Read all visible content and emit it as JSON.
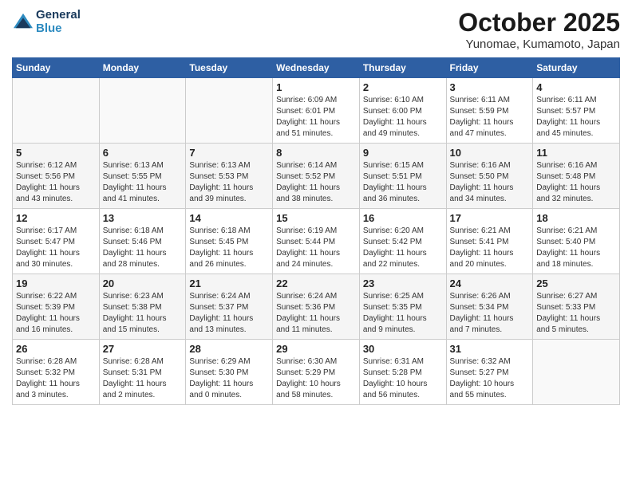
{
  "header": {
    "logo_line1": "General",
    "logo_line2": "Blue",
    "month": "October 2025",
    "location": "Yunomae, Kumamoto, Japan"
  },
  "weekdays": [
    "Sunday",
    "Monday",
    "Tuesday",
    "Wednesday",
    "Thursday",
    "Friday",
    "Saturday"
  ],
  "weeks": [
    [
      {
        "day": "",
        "info": ""
      },
      {
        "day": "",
        "info": ""
      },
      {
        "day": "",
        "info": ""
      },
      {
        "day": "1",
        "info": "Sunrise: 6:09 AM\nSunset: 6:01 PM\nDaylight: 11 hours\nand 51 minutes."
      },
      {
        "day": "2",
        "info": "Sunrise: 6:10 AM\nSunset: 6:00 PM\nDaylight: 11 hours\nand 49 minutes."
      },
      {
        "day": "3",
        "info": "Sunrise: 6:11 AM\nSunset: 5:59 PM\nDaylight: 11 hours\nand 47 minutes."
      },
      {
        "day": "4",
        "info": "Sunrise: 6:11 AM\nSunset: 5:57 PM\nDaylight: 11 hours\nand 45 minutes."
      }
    ],
    [
      {
        "day": "5",
        "info": "Sunrise: 6:12 AM\nSunset: 5:56 PM\nDaylight: 11 hours\nand 43 minutes."
      },
      {
        "day": "6",
        "info": "Sunrise: 6:13 AM\nSunset: 5:55 PM\nDaylight: 11 hours\nand 41 minutes."
      },
      {
        "day": "7",
        "info": "Sunrise: 6:13 AM\nSunset: 5:53 PM\nDaylight: 11 hours\nand 39 minutes."
      },
      {
        "day": "8",
        "info": "Sunrise: 6:14 AM\nSunset: 5:52 PM\nDaylight: 11 hours\nand 38 minutes."
      },
      {
        "day": "9",
        "info": "Sunrise: 6:15 AM\nSunset: 5:51 PM\nDaylight: 11 hours\nand 36 minutes."
      },
      {
        "day": "10",
        "info": "Sunrise: 6:16 AM\nSunset: 5:50 PM\nDaylight: 11 hours\nand 34 minutes."
      },
      {
        "day": "11",
        "info": "Sunrise: 6:16 AM\nSunset: 5:48 PM\nDaylight: 11 hours\nand 32 minutes."
      }
    ],
    [
      {
        "day": "12",
        "info": "Sunrise: 6:17 AM\nSunset: 5:47 PM\nDaylight: 11 hours\nand 30 minutes."
      },
      {
        "day": "13",
        "info": "Sunrise: 6:18 AM\nSunset: 5:46 PM\nDaylight: 11 hours\nand 28 minutes."
      },
      {
        "day": "14",
        "info": "Sunrise: 6:18 AM\nSunset: 5:45 PM\nDaylight: 11 hours\nand 26 minutes."
      },
      {
        "day": "15",
        "info": "Sunrise: 6:19 AM\nSunset: 5:44 PM\nDaylight: 11 hours\nand 24 minutes."
      },
      {
        "day": "16",
        "info": "Sunrise: 6:20 AM\nSunset: 5:42 PM\nDaylight: 11 hours\nand 22 minutes."
      },
      {
        "day": "17",
        "info": "Sunrise: 6:21 AM\nSunset: 5:41 PM\nDaylight: 11 hours\nand 20 minutes."
      },
      {
        "day": "18",
        "info": "Sunrise: 6:21 AM\nSunset: 5:40 PM\nDaylight: 11 hours\nand 18 minutes."
      }
    ],
    [
      {
        "day": "19",
        "info": "Sunrise: 6:22 AM\nSunset: 5:39 PM\nDaylight: 11 hours\nand 16 minutes."
      },
      {
        "day": "20",
        "info": "Sunrise: 6:23 AM\nSunset: 5:38 PM\nDaylight: 11 hours\nand 15 minutes."
      },
      {
        "day": "21",
        "info": "Sunrise: 6:24 AM\nSunset: 5:37 PM\nDaylight: 11 hours\nand 13 minutes."
      },
      {
        "day": "22",
        "info": "Sunrise: 6:24 AM\nSunset: 5:36 PM\nDaylight: 11 hours\nand 11 minutes."
      },
      {
        "day": "23",
        "info": "Sunrise: 6:25 AM\nSunset: 5:35 PM\nDaylight: 11 hours\nand 9 minutes."
      },
      {
        "day": "24",
        "info": "Sunrise: 6:26 AM\nSunset: 5:34 PM\nDaylight: 11 hours\nand 7 minutes."
      },
      {
        "day": "25",
        "info": "Sunrise: 6:27 AM\nSunset: 5:33 PM\nDaylight: 11 hours\nand 5 minutes."
      }
    ],
    [
      {
        "day": "26",
        "info": "Sunrise: 6:28 AM\nSunset: 5:32 PM\nDaylight: 11 hours\nand 3 minutes."
      },
      {
        "day": "27",
        "info": "Sunrise: 6:28 AM\nSunset: 5:31 PM\nDaylight: 11 hours\nand 2 minutes."
      },
      {
        "day": "28",
        "info": "Sunrise: 6:29 AM\nSunset: 5:30 PM\nDaylight: 11 hours\nand 0 minutes."
      },
      {
        "day": "29",
        "info": "Sunrise: 6:30 AM\nSunset: 5:29 PM\nDaylight: 10 hours\nand 58 minutes."
      },
      {
        "day": "30",
        "info": "Sunrise: 6:31 AM\nSunset: 5:28 PM\nDaylight: 10 hours\nand 56 minutes."
      },
      {
        "day": "31",
        "info": "Sunrise: 6:32 AM\nSunset: 5:27 PM\nDaylight: 10 hours\nand 55 minutes."
      },
      {
        "day": "",
        "info": ""
      }
    ]
  ]
}
